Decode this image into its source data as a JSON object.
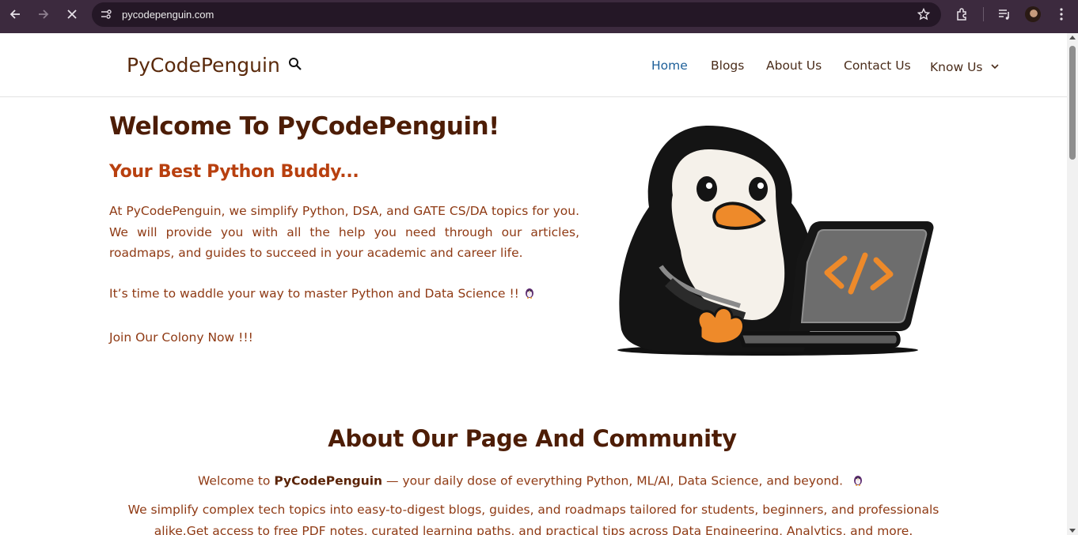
{
  "browser": {
    "url": "pycodepenguin.com",
    "icons": [
      "back-icon",
      "forward-icon",
      "stop-loading-icon",
      "site-info-icon",
      "bookmark-star-icon",
      "extensions-icon",
      "media-controls-icon",
      "profile-avatar",
      "more-menu-icon"
    ]
  },
  "header": {
    "logo": "PyCodePenguin",
    "nav": {
      "home": "Home",
      "blogs": "Blogs",
      "about": "About Us",
      "contact": "Contact Us",
      "know": "Know Us"
    }
  },
  "hero": {
    "title": "Welcome To PyCodePenguin!",
    "subtitle": "Your Best Python Buddy...",
    "paragraph": "At PyCodePenguin, we simplify Python, DSA, and GATE CS/DA topics for you. We will provide you with all the help you need through our articles, roadmaps, and guides to succeed in your academic and career life.",
    "waddle": "It’s time to waddle your way to master Python and Data Science !!",
    "join": "Join Our Colony Now !!!"
  },
  "about": {
    "title": "About Our Page And Community",
    "p1_pre": "Welcome to ",
    "p1_bold": "PyCodePenguin",
    "p1_post": " — your daily dose of everything Python, ML/AI, Data Science, and beyond.",
    "p2": "We simplify complex tech topics into easy-to-digest blogs, guides, and roadmaps tailored for students, beginners, and professionals alike.Get access to free PDF notes, curated learning paths, and practical tips across Data Engineering, Analytics, and more."
  },
  "colors": {
    "chrome_bg": "#3c2a3e",
    "title_brown": "#4d1d06",
    "subtitle_orange": "#b8400f",
    "body_text": "#8f3a14",
    "nav_active": "#1d5f99",
    "penguin_beak": "#ee8a2a"
  }
}
